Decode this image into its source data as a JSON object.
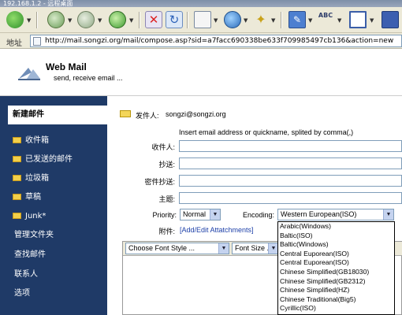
{
  "window": {
    "title": "192.168.1.2 - 远程桌面"
  },
  "address": {
    "label": "地址",
    "url": "http://mail.songzi.org/mail/compose.asp?sid=a7facc690338be633f709985497cb136&action=new"
  },
  "app": {
    "title": "Web Mail",
    "subtitle": "send, receive email ..."
  },
  "sidebar": {
    "compose": "新建邮件",
    "folders": [
      "收件箱",
      "已发送的邮件",
      "垃圾箱",
      "草稿",
      "Junk*"
    ],
    "links": [
      "管理文件夹",
      "查找邮件",
      "联系人",
      "选项"
    ]
  },
  "compose": {
    "from_label": "发件人:",
    "from_value": "songzi@songzi.org",
    "hint": "Insert email address or quickname, splited by comma(,)",
    "to_label": "收件人:",
    "cc_label": "抄送:",
    "bcc_label": "密件抄送:",
    "subject_label": "主题:",
    "priority_label": "Priority:",
    "priority_value": "Normal",
    "encoding_label": "Encoding:",
    "encoding_value": "Western European(ISO)",
    "attach_label": "附件:",
    "attach_link": "[Add/Edit Attatchments]",
    "font_style": "Choose Font Style ...",
    "font_size": "Font Size ..."
  },
  "encoding_options": [
    "Arabic(Windows)",
    "Baltic(ISO)",
    "Baltic(Windows)",
    "Central Euporean(ISO)",
    "Central Euporean(ISO)",
    "Chinese Simplified(GB18030)",
    "Chinese Simplified(GB2312)",
    "Chinese Simplified(HZ)",
    "Chinese Traditional(Big5)",
    "Cyrillic(ISO)"
  ],
  "colors": {
    "sidebar": "#1f3a67",
    "accent_link": "#1c3fa8",
    "toolbar_bg": "#ece9d8"
  }
}
